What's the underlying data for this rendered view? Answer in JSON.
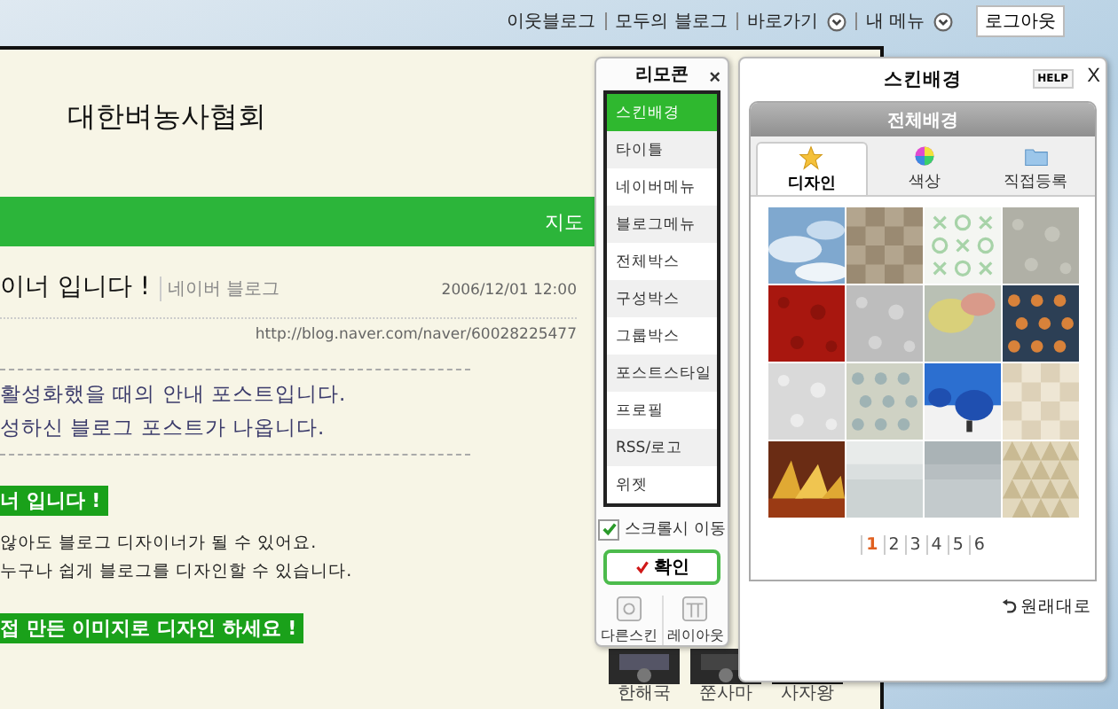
{
  "top_nav": {
    "links": [
      {
        "label": "이웃블로그",
        "kind": "link"
      },
      {
        "label": "모두의 블로그",
        "kind": "link"
      },
      {
        "label": "바로가기",
        "kind": "menu"
      },
      {
        "label": "내 메뉴",
        "kind": "menu"
      }
    ],
    "logout": "로그아웃"
  },
  "blog": {
    "title": "대한벼농사협회",
    "nav_label": "지도",
    "post_title": "이너 입니다 !",
    "post_source": "네이버 블로그",
    "post_date": "2006/12/01 12:00",
    "post_url": "http://blog.naver.com/naver/60028225477",
    "intro_lines": [
      "활성화했을 때의 안내 포스트입니다.",
      "성하신 블로그 포스트가 나옵니다."
    ],
    "heading_1": "너 입니다 !",
    "body_lines": [
      "않아도 블로그 디자이너가 될 수 있어요.",
      "누구나 쉽게 블로그를 디자인할 수 있습니다."
    ],
    "heading_2": "접 만든 이미지로 디자인 하세요 !",
    "thumbnails": [
      {
        "caption": "한해국"
      },
      {
        "caption": "쭌사마"
      },
      {
        "caption": "사자왕"
      }
    ]
  },
  "remote": {
    "title": "리모콘",
    "close": "×",
    "items": [
      {
        "label": "스킨배경",
        "selected": true
      },
      {
        "label": "타이틀",
        "selected": false
      },
      {
        "label": "네이버메뉴",
        "selected": false
      },
      {
        "label": "블로그메뉴",
        "selected": false
      },
      {
        "label": "전체박스",
        "selected": false
      },
      {
        "label": "구성박스",
        "selected": false
      },
      {
        "label": "그룹박스",
        "selected": false
      },
      {
        "label": "포스트스타일",
        "selected": false
      },
      {
        "label": "프로필",
        "selected": false
      },
      {
        "label": "RSS/로고",
        "selected": false
      },
      {
        "label": "위젯",
        "selected": false
      }
    ],
    "scroll_follow": {
      "label": "스크롤시 이동",
      "checked": true
    },
    "confirm": "확인",
    "tools": [
      {
        "label": "다른스킨",
        "kind": "skin"
      },
      {
        "label": "레이아웃",
        "kind": "layout"
      }
    ]
  },
  "skin_panel": {
    "title": "스킨배경",
    "help": "HELP",
    "close": "X",
    "section": "전체배경",
    "tabs": [
      {
        "label": "디자인",
        "kind": "star",
        "selected": true
      },
      {
        "label": "색상",
        "kind": "color",
        "selected": false
      },
      {
        "label": "직접등록",
        "kind": "folder",
        "selected": false
      }
    ],
    "pages": [
      {
        "label": "1",
        "selected": true
      },
      {
        "label": "2",
        "selected": false
      },
      {
        "label": "3",
        "selected": false
      },
      {
        "label": "4",
        "selected": false
      },
      {
        "label": "5",
        "selected": false
      },
      {
        "label": "6",
        "selected": false
      }
    ],
    "reset": "원래대로"
  }
}
